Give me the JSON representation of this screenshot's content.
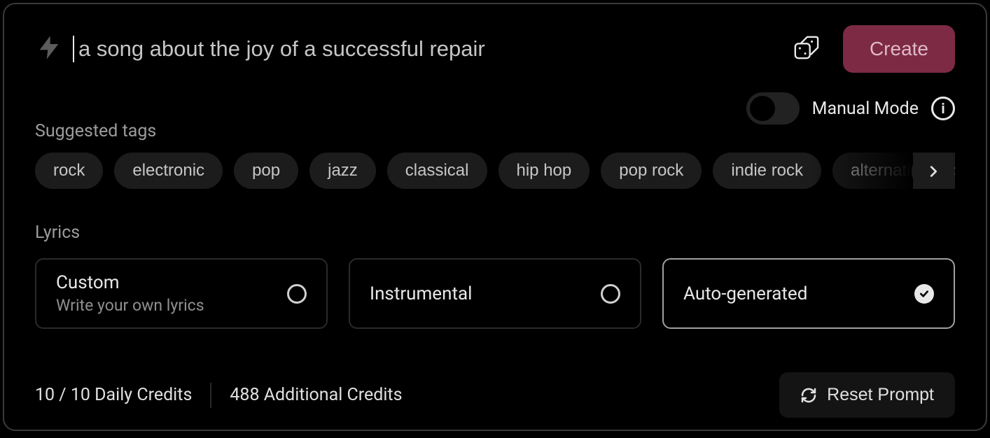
{
  "prompt": {
    "placeholder": "a song about the joy of a successful repair",
    "value": ""
  },
  "create_label": "Create",
  "manual_mode": {
    "label": "Manual Mode",
    "enabled": false
  },
  "suggested_tags": {
    "label": "Suggested tags",
    "items": [
      "rock",
      "electronic",
      "pop",
      "jazz",
      "classical",
      "hip hop",
      "pop rock",
      "indie rock",
      "alternative rock"
    ]
  },
  "lyrics": {
    "label": "Lyrics",
    "options": [
      {
        "title": "Custom",
        "subtitle": "Write your own lyrics",
        "selected": false
      },
      {
        "title": "Instrumental",
        "subtitle": "",
        "selected": false
      },
      {
        "title": "Auto-generated",
        "subtitle": "",
        "selected": true
      }
    ]
  },
  "footer": {
    "daily_credits": "10 / 10 Daily Credits",
    "additional_credits": "488 Additional Credits",
    "reset_label": "Reset Prompt"
  }
}
